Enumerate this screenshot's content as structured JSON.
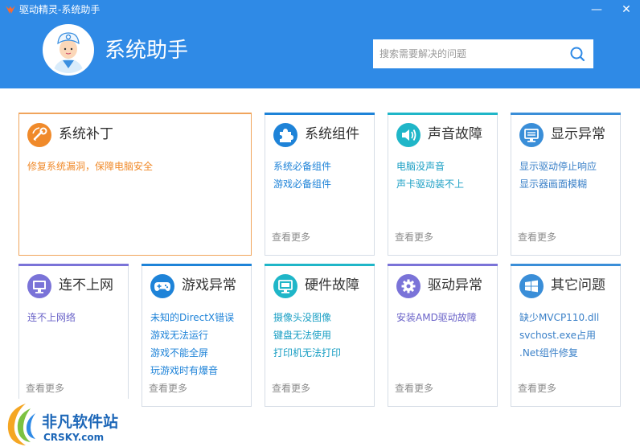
{
  "window": {
    "title": "驱动精灵-系统助手",
    "minimize_glyph": "—",
    "close_glyph": "✕"
  },
  "header": {
    "title": "系统助手",
    "search": {
      "placeholder": "搜索需要解决的问题",
      "value": ""
    }
  },
  "cards": [
    {
      "title": "系统补丁",
      "icon": "patch-icon",
      "links": [
        "修复系统漏洞，保障电脑安全"
      ],
      "more": ""
    },
    {
      "title": "系统组件",
      "icon": "puzzle-icon",
      "links": [
        "系统必备组件",
        "游戏必备组件"
      ],
      "more": "查看更多"
    },
    {
      "title": "声音故障",
      "icon": "speaker-icon",
      "links": [
        "电脑没声音",
        "声卡驱动装不上"
      ],
      "more": "查看更多"
    },
    {
      "title": "显示异常",
      "icon": "display-icon",
      "links": [
        "显示驱动停止响应",
        "显示器画面模糊"
      ],
      "more": "查看更多"
    },
    {
      "title": "连不上网",
      "icon": "network-monitor-icon",
      "links": [
        "连不上网络"
      ],
      "more": "查看更多"
    },
    {
      "title": "游戏异常",
      "icon": "gamepad-icon",
      "links": [
        "未知的DirectX错误",
        "游戏无法运行",
        "游戏不能全屏",
        "玩游戏时有爆音"
      ],
      "more": "查看更多"
    },
    {
      "title": "硬件故障",
      "icon": "hardware-monitor-icon",
      "links": [
        "摄像头没图像",
        "键盘无法使用",
        "打印机无法打印"
      ],
      "more": "查看更多"
    },
    {
      "title": "驱动异常",
      "icon": "gear-icon",
      "links": [
        "安装AMD驱动故障"
      ],
      "more": "查看更多"
    },
    {
      "title": "其它问题",
      "icon": "windows-icon",
      "links": [
        "缺少MVCP110.dll",
        "svchost.exe占用",
        ".Net组件修复"
      ],
      "more": "查看更多"
    }
  ],
  "watermark": {
    "text": "非凡软件站",
    "url": "CRSKY.com"
  },
  "colors": {
    "header": "#2f8ae6",
    "orange": "#f08a2a",
    "blue": "#1e83d8",
    "teal": "#1fb6c8",
    "purple": "#7a73d8"
  }
}
